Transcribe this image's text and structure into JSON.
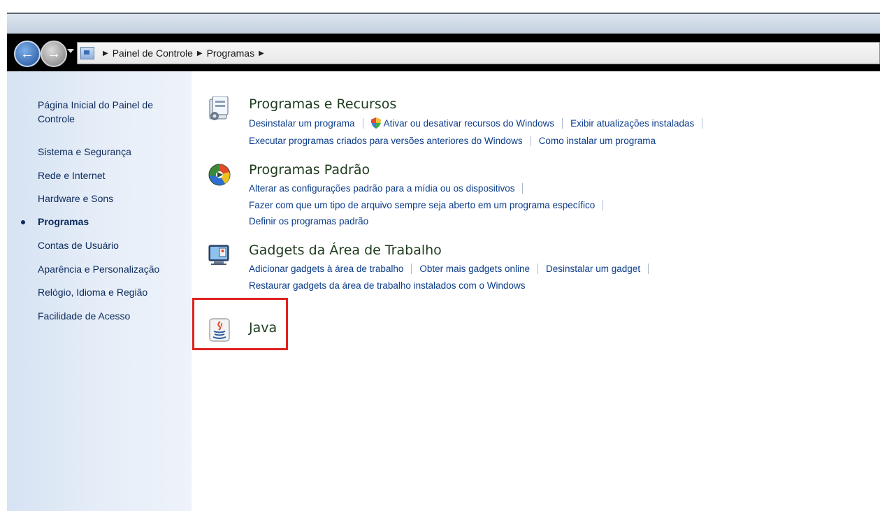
{
  "breadcrumb": {
    "items": [
      "Painel de Controle",
      "Programas"
    ]
  },
  "sidebar": {
    "items": [
      {
        "label": "Página Inicial do Painel de Controle"
      },
      {
        "label": "Sistema e Segurança"
      },
      {
        "label": "Rede e Internet"
      },
      {
        "label": "Hardware e Sons"
      },
      {
        "label": "Programas",
        "current": true
      },
      {
        "label": "Contas de Usuário"
      },
      {
        "label": "Aparência e Personalização"
      },
      {
        "label": "Relógio, Idioma e Região"
      },
      {
        "label": "Facilidade de Acesso"
      }
    ]
  },
  "sections": [
    {
      "title": "Programas e Recursos",
      "icon": "programs-features-icon",
      "links": [
        [
          "Desinstalar um programa",
          "Ativar ou desativar recursos do Windows",
          "Exibir atualizações instaladas"
        ],
        [
          "Executar programas criados para versões anteriores do Windows",
          "Como instalar um programa"
        ]
      ]
    },
    {
      "title": "Programas Padrão",
      "icon": "default-programs-icon",
      "links": [
        [
          "Alterar as configurações padrão para a mídia ou os dispositivos"
        ],
        [
          "Fazer com que um tipo de arquivo sempre seja aberto em um programa específico"
        ],
        [
          "Definir os programas padrão"
        ]
      ]
    },
    {
      "title": "Gadgets da Área de Trabalho",
      "icon": "desktop-gadgets-icon",
      "links": [
        [
          "Adicionar gadgets à área de trabalho",
          "Obter mais gadgets online",
          "Desinstalar um gadget"
        ],
        [
          "Restaurar gadgets da área de trabalho instalados com o Windows"
        ]
      ]
    },
    {
      "title": "Java",
      "icon": "java-icon",
      "links": []
    }
  ],
  "colors": {
    "highlight_border": "#e02020",
    "link": "#0b3c8a",
    "sidebar_text": "#0b2a5c"
  }
}
